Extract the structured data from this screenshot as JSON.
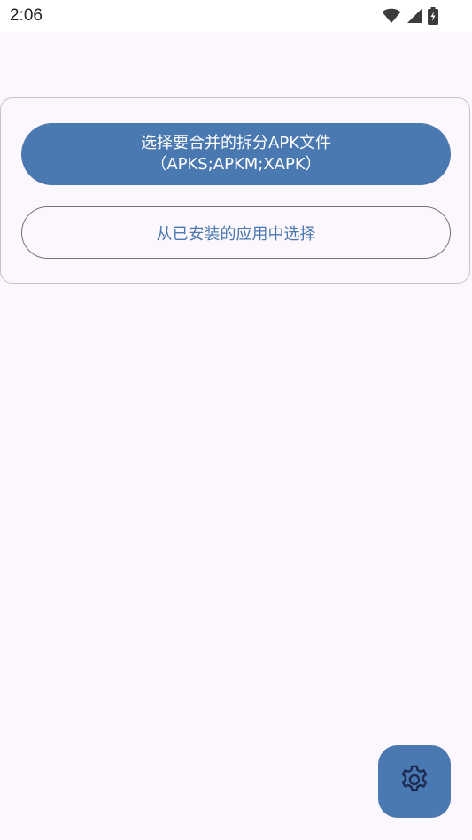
{
  "status_bar": {
    "time": "2:06",
    "icons": [
      "wifi-icon",
      "signal-icon",
      "battery-charging-icon"
    ]
  },
  "main": {
    "select_split_apk_button": {
      "line1": "选择要合并的拆分APK文件",
      "line2": "（APKS;APKM;XAPK）"
    },
    "select_installed_button": {
      "label": "从已安装的应用中选择"
    }
  },
  "fab": {
    "icon": "gear-icon"
  },
  "colors": {
    "background": "#fcf6fd",
    "accent": "#4a78b1",
    "outline": "#75707b"
  }
}
